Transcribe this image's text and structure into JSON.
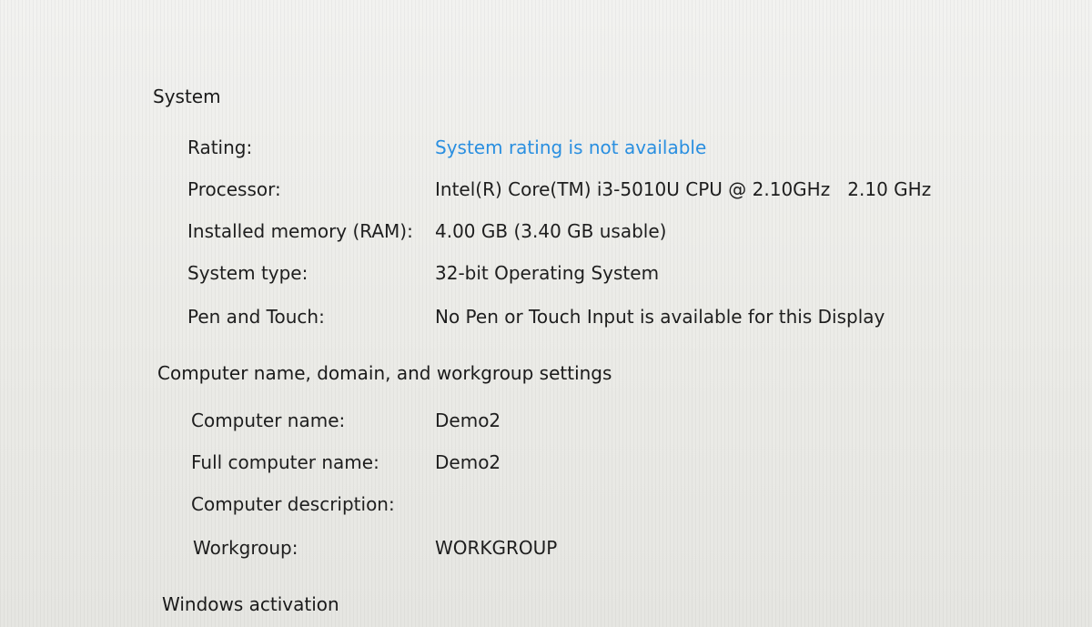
{
  "system": {
    "heading": "System",
    "rows": [
      {
        "label": "Rating:",
        "value": "System rating is not available"
      },
      {
        "label": "Processor:",
        "value": "Intel(R) Core(TM) i3-5010U CPU @ 2.10GHz   2.10 GHz"
      },
      {
        "label": "Installed memory (RAM):",
        "value": "4.00 GB (3.40 GB usable)"
      },
      {
        "label": "System type:",
        "value": "32-bit Operating System"
      },
      {
        "label": "Pen and Touch:",
        "value": "No Pen or Touch Input is available for this Display"
      }
    ]
  },
  "computer": {
    "heading": "Computer name, domain, and workgroup settings",
    "rows": [
      {
        "label": "Computer name:",
        "value": "Demo2"
      },
      {
        "label": "Full computer name:",
        "value": "Demo2"
      },
      {
        "label": "Computer description:",
        "value": ""
      },
      {
        "label": "Workgroup:",
        "value": "WORKGROUP"
      }
    ]
  },
  "activation": {
    "heading": "Windows activation"
  },
  "colors": {
    "link": "#2a8fe0",
    "text": "#1e1e1e",
    "background": "#ecece8"
  }
}
